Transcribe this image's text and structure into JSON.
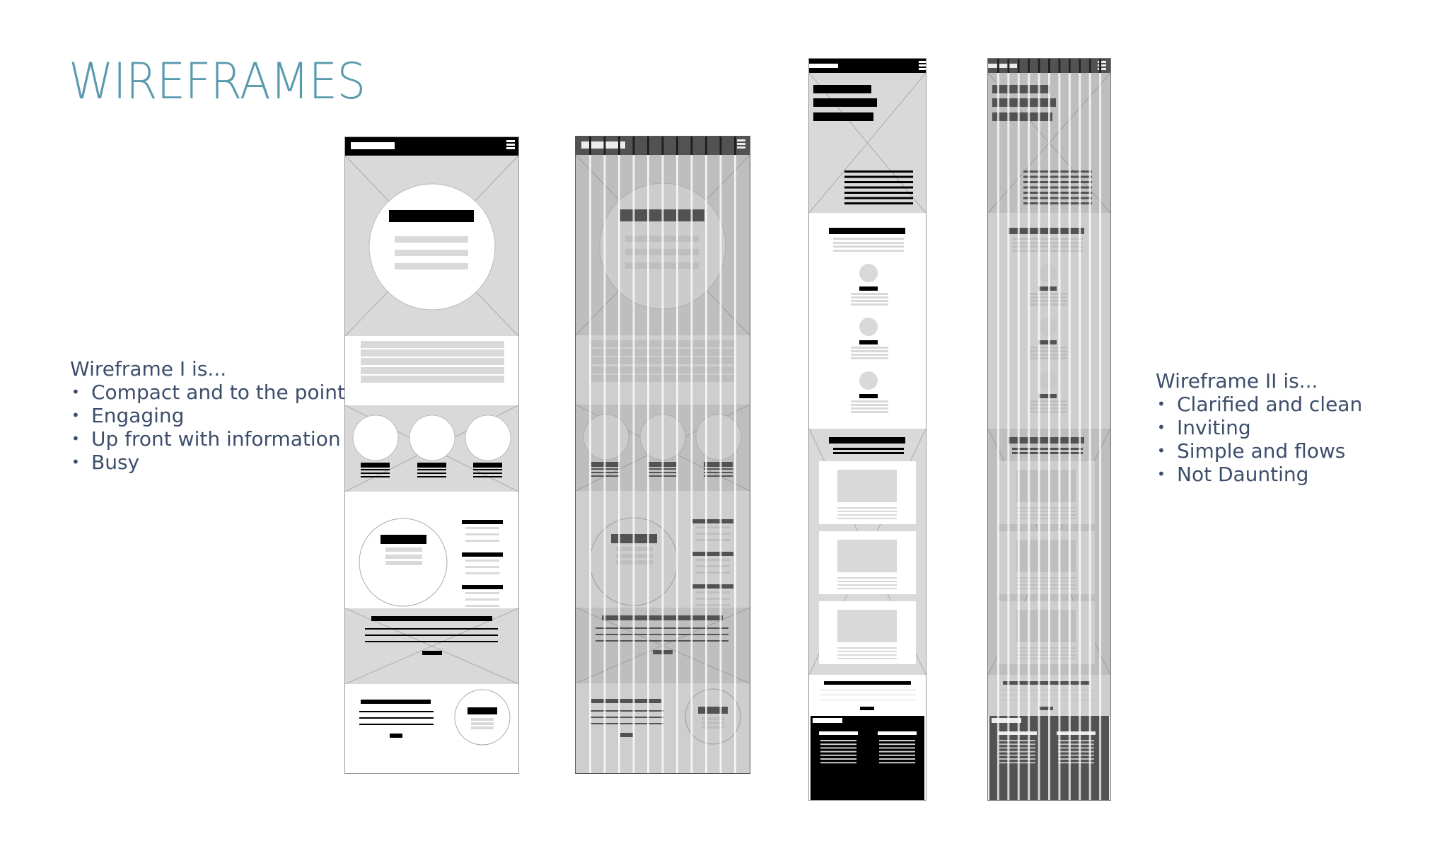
{
  "page_title": "WIREFRAMES",
  "colors": {
    "title": "#5a9aae",
    "body_text": "#3d4e6b",
    "placeholder_fill": "#d9d9d9",
    "content_block": "#000000",
    "text_line": "#d9d9d9"
  },
  "wireframe_1_notes": {
    "heading": "Wireframe I is...",
    "bullets": [
      "Compact and to the point",
      "Engaging",
      "Up front with information",
      "Busy"
    ]
  },
  "wireframe_2_notes": {
    "heading": "Wireframe II is...",
    "bullets": [
      "Clarified and clean",
      "Inviting",
      "Simple and flows",
      "Not Daunting"
    ]
  },
  "wireframes": [
    {
      "name": "wireframe-1",
      "variant": "plain",
      "grid_columns": 0
    },
    {
      "name": "wireframe-1-grid",
      "variant": "grid-overlay",
      "grid_columns": 12
    },
    {
      "name": "wireframe-2",
      "variant": "plain",
      "grid_columns": 0
    },
    {
      "name": "wireframe-2-grid",
      "variant": "grid-overlay",
      "grid_columns": 12
    }
  ],
  "icons": {
    "menu": "hamburger-menu-icon",
    "image_placeholder": "image-placeholder-icon"
  }
}
